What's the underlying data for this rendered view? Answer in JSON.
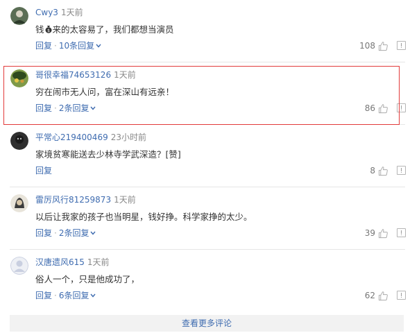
{
  "comments": [
    {
      "username": "Cwy3",
      "time": "1天前",
      "text_before": "钱",
      "text_after": "来的太容易了，我们都想当演员",
      "reply_label": "回复",
      "separator": "·",
      "replies_label": "10条回复",
      "likes": "108",
      "avatar_color": "#5b6e55"
    },
    {
      "username": "哥很幸福74653126",
      "time": "1天前",
      "text": "穷在闹市无人问，富在深山有远亲！",
      "reply_label": "回复",
      "separator": "·",
      "replies_label": "2条回复",
      "likes": "86",
      "avatar_color": "#6c8a3a"
    },
    {
      "username": "平常心219400469",
      "time": "23小时前",
      "text": "家境贫寒能送去少林寺学武深造？[赞]",
      "reply_label": "回复",
      "likes": "8",
      "avatar_color": "#2f2f2f"
    },
    {
      "username": "雷厉风行81259873",
      "time": "1天前",
      "text": "以后让我家的孩子也当明星，钱好挣。科学家挣的太少。",
      "reply_label": "回复",
      "separator": "·",
      "replies_label": "2条回复",
      "likes": "39",
      "avatar_color": "#4a4a4a"
    },
    {
      "username": "汉唐遗风615",
      "time": "1天前",
      "text": "俗人一个，只是他成功了，",
      "reply_label": "回复",
      "separator": "·",
      "replies_label": "6条回复",
      "likes": "62",
      "avatar_color": "#c9cfe0"
    }
  ],
  "more_comments_label": "查看更多评论",
  "colors": {
    "link": "#3f6cb0",
    "highlight": "#e23a3a"
  }
}
